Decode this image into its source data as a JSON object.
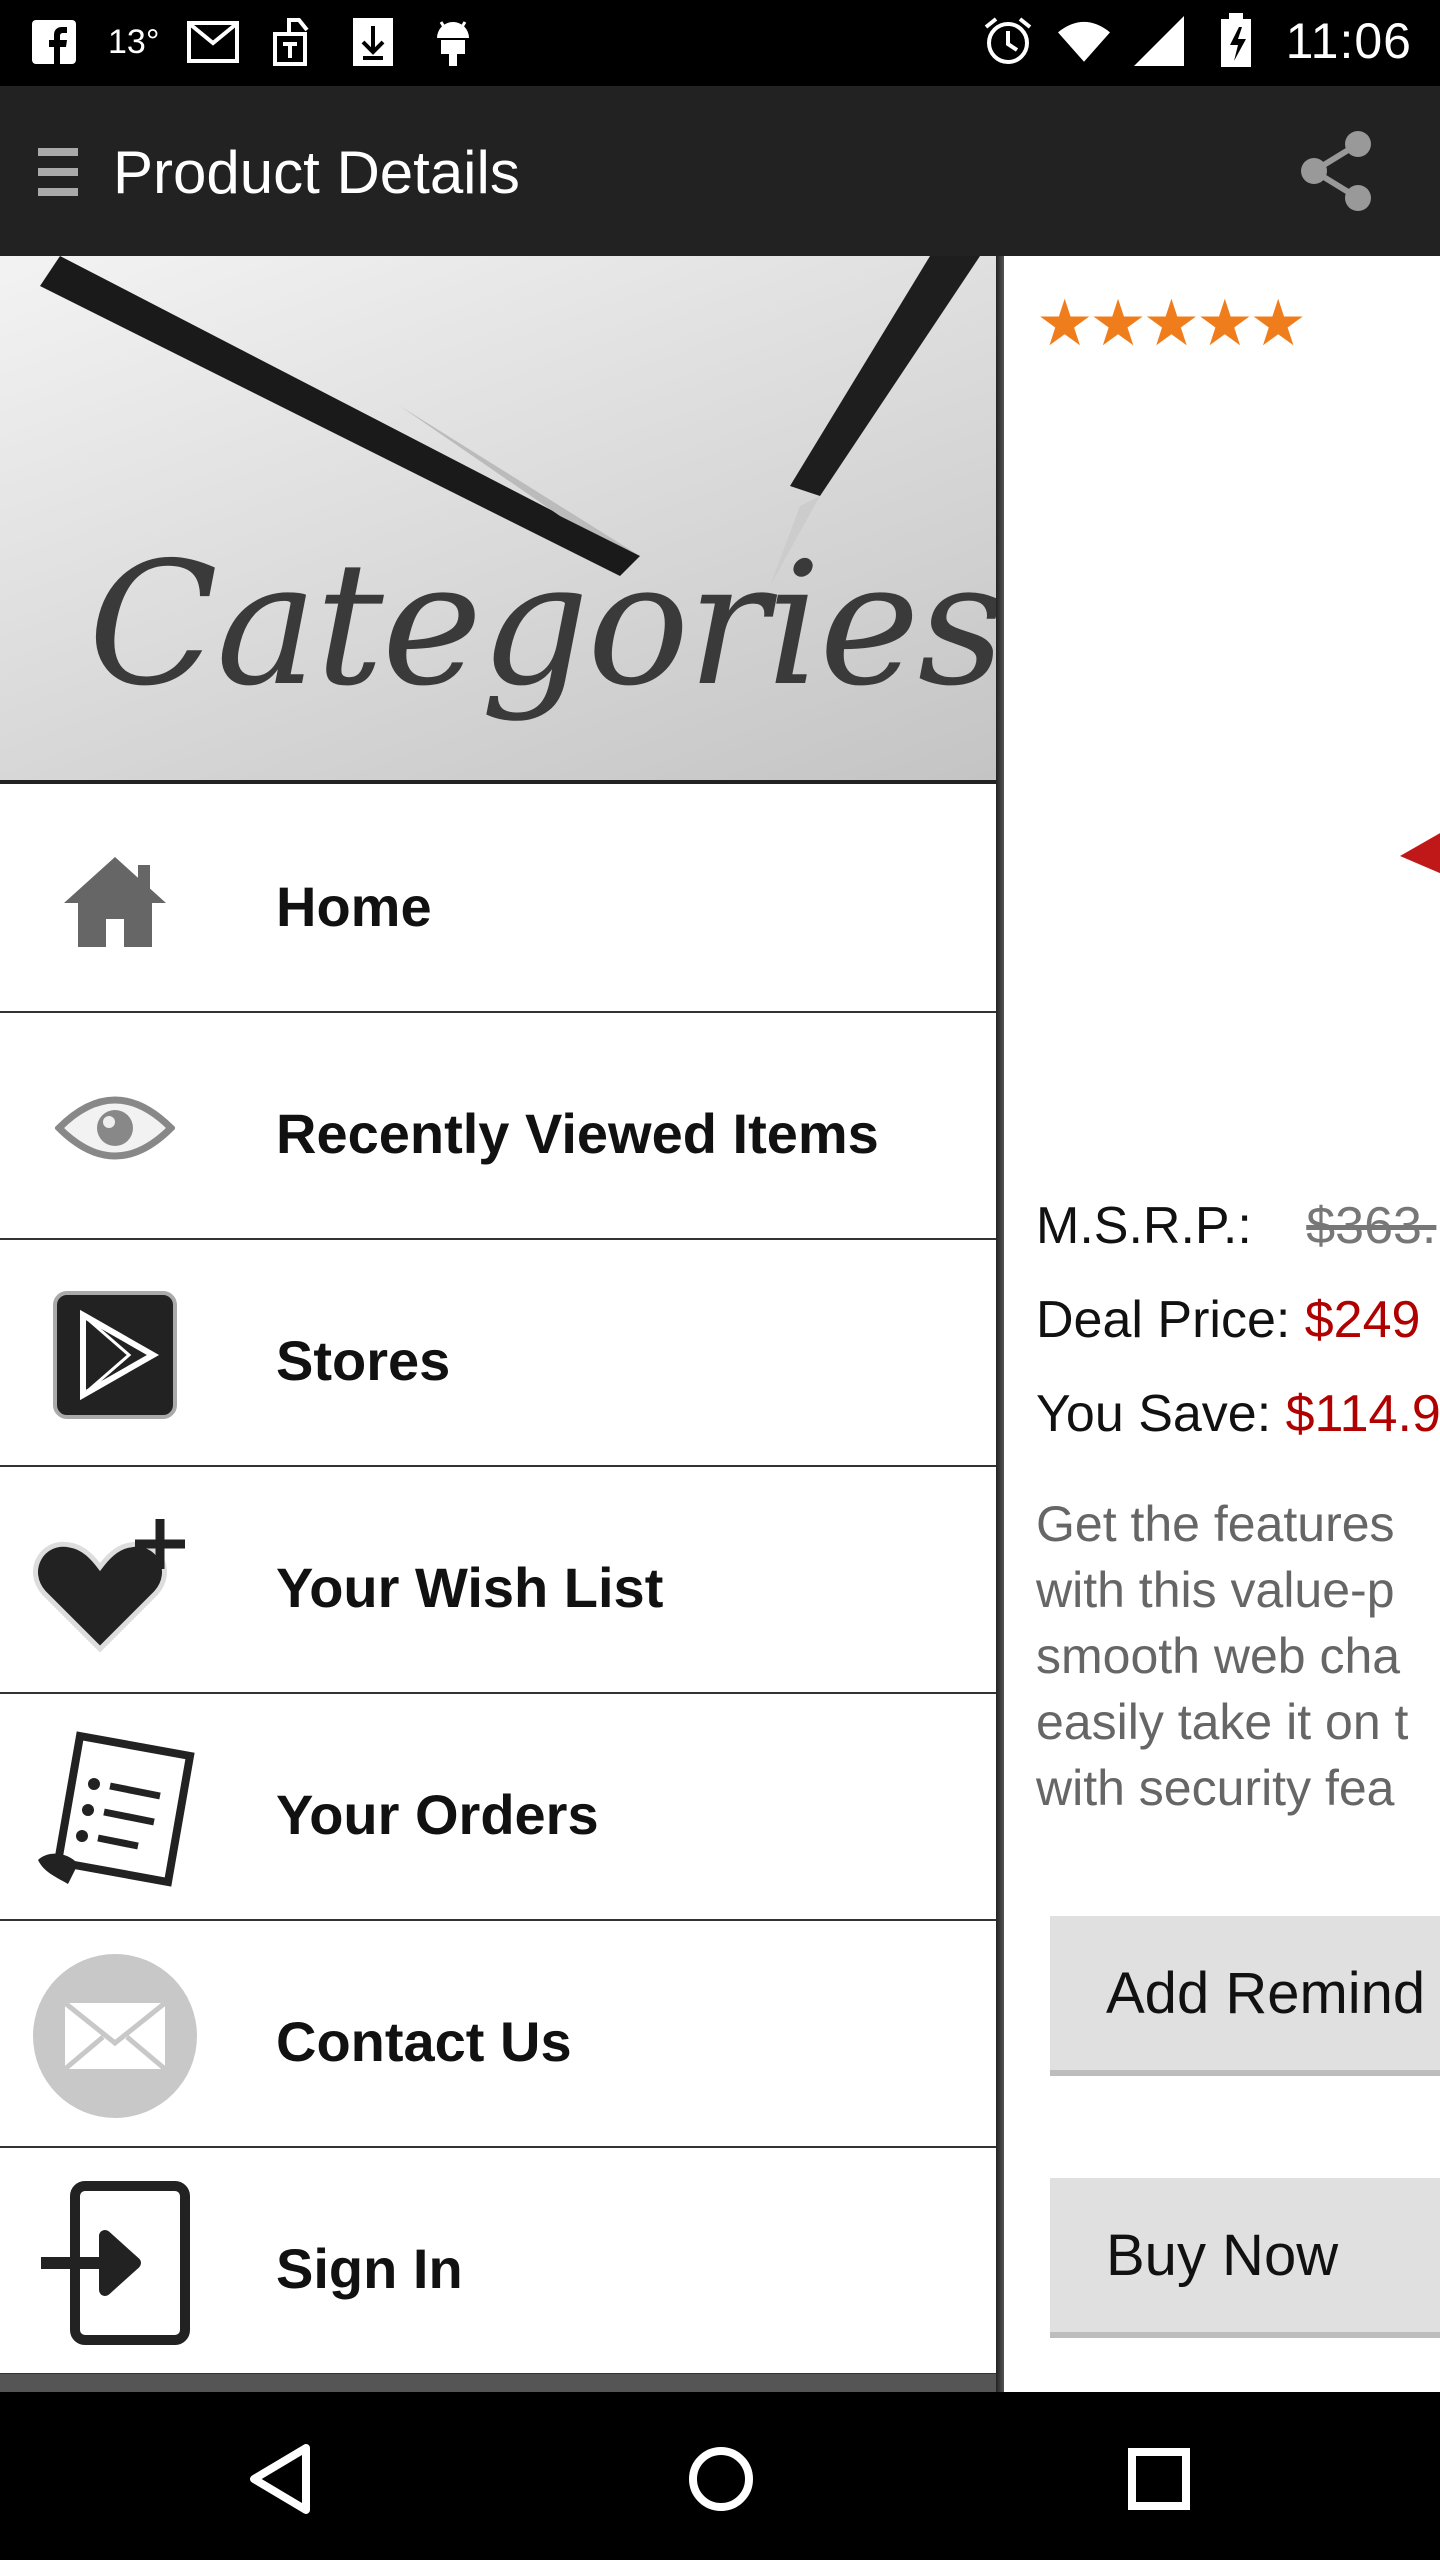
{
  "status_bar": {
    "temperature": "13°",
    "time": "11:06",
    "icons": [
      "facebook-icon",
      "gmail-icon",
      "download-tool-icon",
      "download-icon",
      "android-icon",
      "alarm-icon",
      "wifi-icon",
      "signal-icon",
      "battery-icon"
    ]
  },
  "toolbar": {
    "title": "Product Details",
    "share_icon": "share-icon",
    "menu_icon": "hamburger-icon"
  },
  "drawer": {
    "banner_text": "Categories",
    "items": [
      {
        "label": "Home",
        "icon": "home-icon"
      },
      {
        "label": "Recently Viewed Items",
        "icon": "eye-icon"
      },
      {
        "label": "Stores",
        "icon": "play-store-icon"
      },
      {
        "label": "Your Wish List",
        "icon": "heart-plus-icon"
      },
      {
        "label": "Your Orders",
        "icon": "receipt-icon"
      },
      {
        "label": "Contact Us",
        "icon": "envelope-icon"
      },
      {
        "label": "Sign In",
        "icon": "sign-in-icon"
      }
    ]
  },
  "product": {
    "stars": "★★★★★",
    "rating": 5,
    "msrp_label": "M.S.R.P.:",
    "msrp_value": "$363.",
    "deal_label": "Deal Price:",
    "deal_value": "$249",
    "save_label": "You Save:",
    "save_value": "$114.9",
    "description_lines": [
      "Get the features",
      "with this value-p",
      "smooth web cha",
      "easily take it on t",
      "with security fea"
    ],
    "add_reminder_label": "Add Remind",
    "buy_now_label": "Buy Now"
  },
  "colors": {
    "toolbar": "#222222",
    "price_red": "#b00000",
    "star_orange": "#f07d1c"
  },
  "nav_bar": {
    "icons": [
      "back-icon",
      "home-circle-icon",
      "recents-icon"
    ]
  }
}
